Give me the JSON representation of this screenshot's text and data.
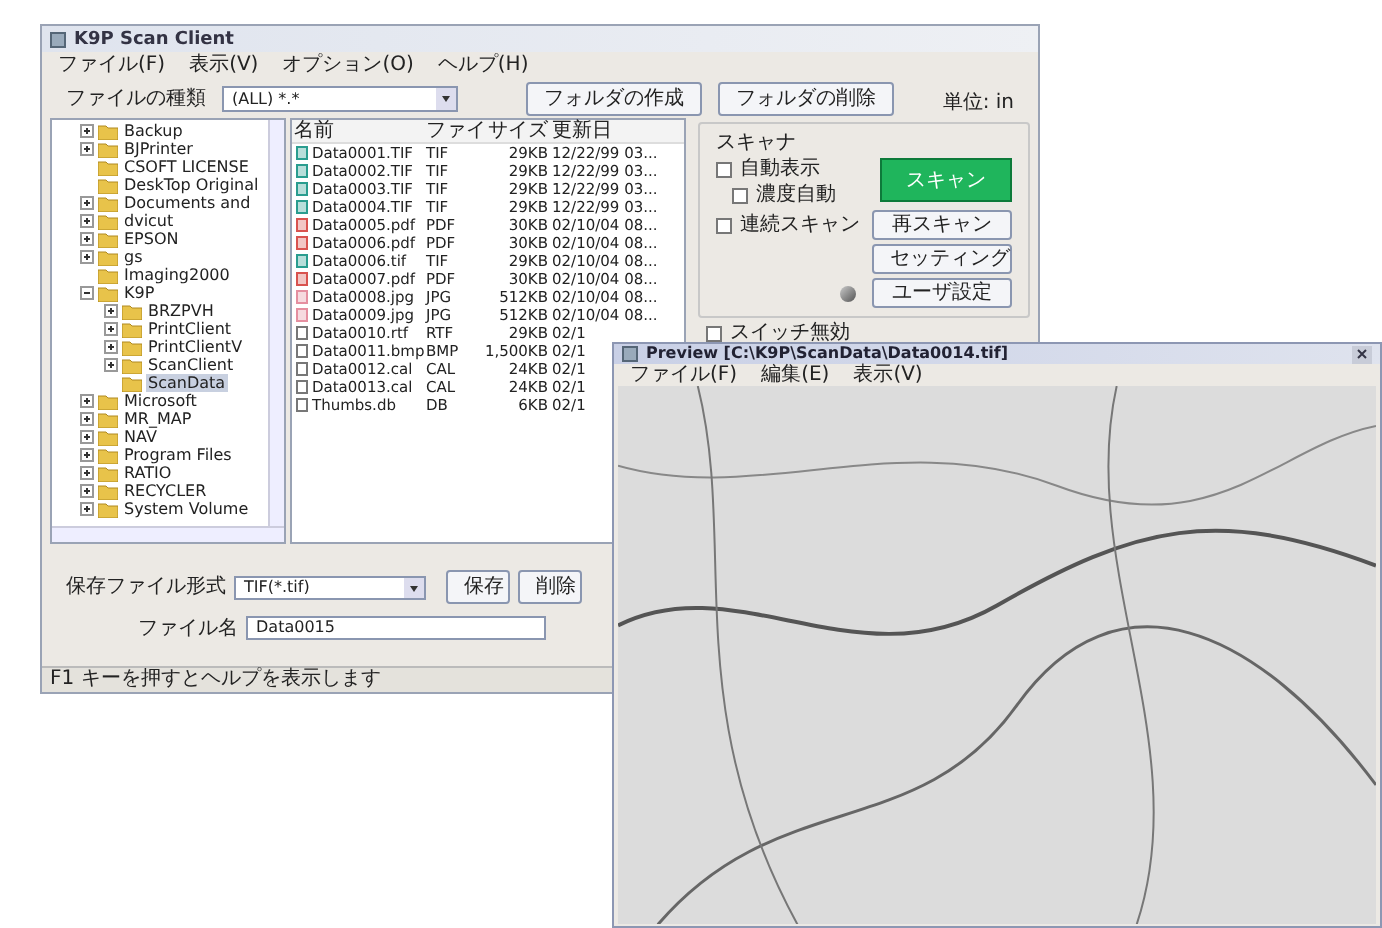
{
  "main_window": {
    "title": "K9P Scan Client",
    "menu": [
      "ファイル(F)",
      "表示(V)",
      "オプション(O)",
      "ヘルプ(H)"
    ],
    "file_type": {
      "label": "ファイルの種類",
      "value": "(ALL) *.*"
    },
    "toolbar_buttons": [
      "フォルダの作成",
      "フォルダの削除"
    ],
    "unit": "単位: in",
    "tree": [
      {
        "label": "Backup",
        "expanded": false,
        "selected": false
      },
      {
        "label": "BJPrinter",
        "expanded": false,
        "selected": false
      },
      {
        "label": "CSOFT LICENSE",
        "selected": false
      },
      {
        "label": "DeskTop Original",
        "selected": false
      },
      {
        "label": "Documents and",
        "expanded": false,
        "selected": false
      },
      {
        "label": "dvicut",
        "expanded": false,
        "selected": false
      },
      {
        "label": "EPSON",
        "expanded": false,
        "selected": false
      },
      {
        "label": "gs",
        "expanded": false,
        "selected": false
      },
      {
        "label": "Imaging2000",
        "selected": false
      },
      {
        "label": "K9P",
        "expanded": true,
        "selected": false,
        "children": [
          {
            "label": "BRZPVH",
            "expanded": false,
            "selected": false
          },
          {
            "label": "PrintClient",
            "expanded": false,
            "selected": false
          },
          {
            "label": "PrintClientV",
            "expanded": false,
            "selected": false
          },
          {
            "label": "ScanClient",
            "expanded": false,
            "selected": false
          },
          {
            "label": "ScanData",
            "selected": true
          }
        ]
      },
      {
        "label": "Microsoft",
        "expanded": false,
        "selected": false
      },
      {
        "label": "MR_MAP",
        "expanded": false,
        "selected": false
      },
      {
        "label": "NAV",
        "expanded": false,
        "selected": false
      },
      {
        "label": "Program Files",
        "expanded": false,
        "selected": false
      },
      {
        "label": "RATIO",
        "expanded": false,
        "selected": false
      },
      {
        "label": "RECYCLER",
        "expanded": false,
        "selected": false
      },
      {
        "label": "System Volume",
        "expanded": false,
        "selected": false
      }
    ],
    "file_list": {
      "columns": [
        "名前",
        "ファイ",
        "サイズ",
        "更新日"
      ],
      "rows": [
        {
          "kind": "image",
          "cells": [
            "Data0001.TIF",
            "TIF",
            "29KB",
            "12/22/99 03..."
          ]
        },
        {
          "kind": "image",
          "cells": [
            "Data0002.TIF",
            "TIF",
            "29KB",
            "12/22/99 03..."
          ]
        },
        {
          "kind": "image",
          "cells": [
            "Data0003.TIF",
            "TIF",
            "29KB",
            "12/22/99 03..."
          ]
        },
        {
          "kind": "image",
          "cells": [
            "Data0004.TIF",
            "TIF",
            "29KB",
            "12/22/99 03..."
          ]
        },
        {
          "kind": "pdf",
          "cells": [
            "Data0005.pdf",
            "PDF",
            "30KB",
            "02/10/04 08..."
          ]
        },
        {
          "kind": "pdf",
          "cells": [
            "Data0006.pdf",
            "PDF",
            "30KB",
            "02/10/04 08..."
          ]
        },
        {
          "kind": "image",
          "cells": [
            "Data0006.tif",
            "TIF",
            "29KB",
            "02/10/04 08..."
          ]
        },
        {
          "kind": "pdf",
          "cells": [
            "Data0007.pdf",
            "PDF",
            "30KB",
            "02/10/04 08..."
          ]
        },
        {
          "kind": "photo",
          "cells": [
            "Data0008.jpg",
            "JPG",
            "512KB",
            "02/10/04 08..."
          ]
        },
        {
          "kind": "photo",
          "cells": [
            "Data0009.jpg",
            "JPG",
            "512KB",
            "02/10/04 08..."
          ]
        },
        {
          "kind": "document",
          "cells": [
            "Data0010.rtf",
            "RTF",
            "29KB",
            "02/1"
          ]
        },
        {
          "kind": "document",
          "cells": [
            "Data0011.bmp",
            "BMP",
            "1,500KB",
            "02/1"
          ]
        },
        {
          "kind": "document",
          "cells": [
            "Data0012.cal",
            "CAL",
            "24KB",
            "02/1"
          ]
        },
        {
          "kind": "document",
          "cells": [
            "Data0013.cal",
            "CAL",
            "24KB",
            "02/1"
          ]
        },
        {
          "kind": "document",
          "cells": [
            "Thumbs.db",
            "DB",
            "6KB",
            "02/1"
          ]
        }
      ]
    },
    "scanner": {
      "title": "スキャナ",
      "checkboxes": [
        {
          "label": "自動表示",
          "checked": false
        },
        {
          "label": "濃度自動",
          "checked": false
        },
        {
          "label": "連続スキャン",
          "checked": false
        }
      ],
      "scan_button": "スキャン",
      "buttons": [
        "再スキャン",
        "セッティング",
        "ユーザ設定"
      ],
      "switch": {
        "label": "スイッチ無効",
        "checked": false
      }
    },
    "save_format": {
      "label": "保存ファイル形式",
      "value": "TIF(*.tif)"
    },
    "file_name": {
      "label": "ファイル名",
      "value": "Data0015"
    },
    "bottom_buttons": [
      "保存",
      "削除"
    ],
    "status_bar": "F1 キーを押すとヘルプを表示します"
  },
  "preview_window": {
    "title": "Preview [C:\\K9P\\ScanData\\Data0014.tif]",
    "menu": [
      "ファイル(F)",
      "編集(E)",
      "表示(V)"
    ]
  }
}
